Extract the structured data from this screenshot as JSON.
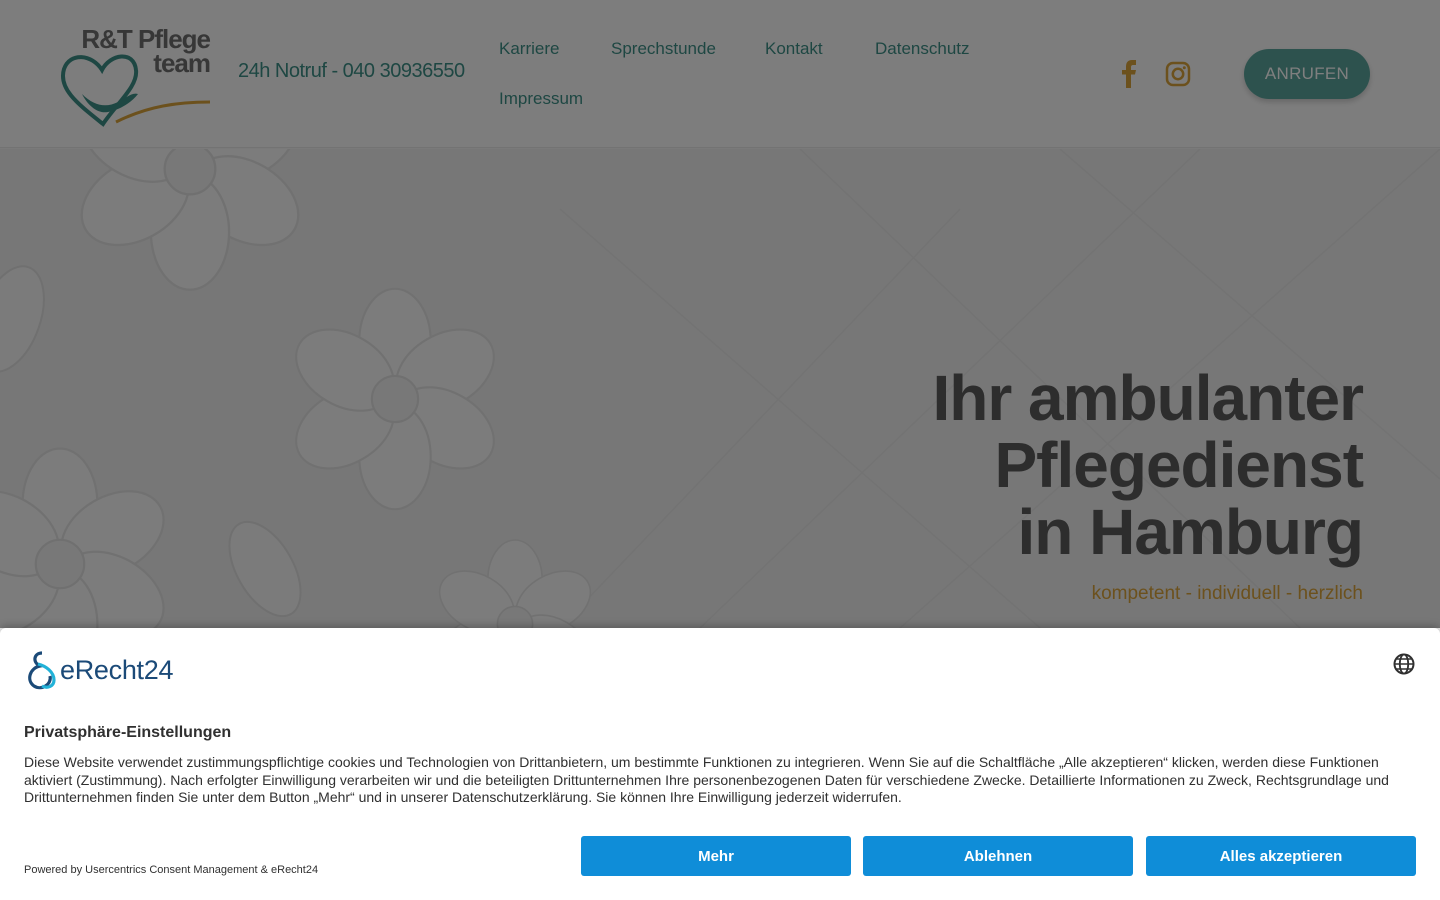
{
  "header": {
    "logo_line1": "R&T Pflege",
    "logo_line2": "team",
    "hotline": "24h Notruf - 040 30936550",
    "nav": [
      {
        "label": "Karriere"
      },
      {
        "label": "Sprechstunde"
      },
      {
        "label": "Kontakt"
      },
      {
        "label": "Datenschutz"
      },
      {
        "label": "Impressum"
      }
    ],
    "social": [
      {
        "icon": "facebook-icon"
      },
      {
        "icon": "instagram-icon"
      }
    ],
    "call_button": "ANRUFEN"
  },
  "hero": {
    "title_lines": [
      "Ihr ambulanter",
      "Pflegedienst",
      "in Hamburg"
    ],
    "subtitle": "kompetent - individuell - herzlich"
  },
  "consent": {
    "brand": "eRecht24",
    "title": "Privatsphäre-Einstellungen",
    "text": "Diese Website verwendet zustimmungspflichtige cookies und Technologien von Drittanbietern, um bestimmte Funktionen zu integrieren. Wenn Sie auf die Schaltfläche „Alle akzeptieren“ klicken, werden diese Funktionen aktiviert (Zustimmung). Nach erfolgter Einwilligung verarbeiten wir und die beteiligten Drittunternehmen Ihre personenbezogenen Daten für verschiedene Zwecke. Detaillierte Informationen zu Zweck, Rechtsgrundlage und Drittunternehmen finden Sie unter dem Button „Mehr“ und in unserer Datenschutzerklärung. Sie können Ihre Einwilligung jederzeit widerrufen.",
    "powered_by": "Powered by Usercentrics Consent Management & eRecht24",
    "buttons": {
      "more": "Mehr",
      "deny": "Ablehnen",
      "accept_all": "Alles akzeptieren"
    }
  },
  "colors": {
    "teal": "#3d8f86",
    "button_teal": "#5ba59c",
    "gold": "#d9a23a",
    "consent_blue": "#0f8dd8",
    "erecht_navy": "#1b4a78"
  }
}
